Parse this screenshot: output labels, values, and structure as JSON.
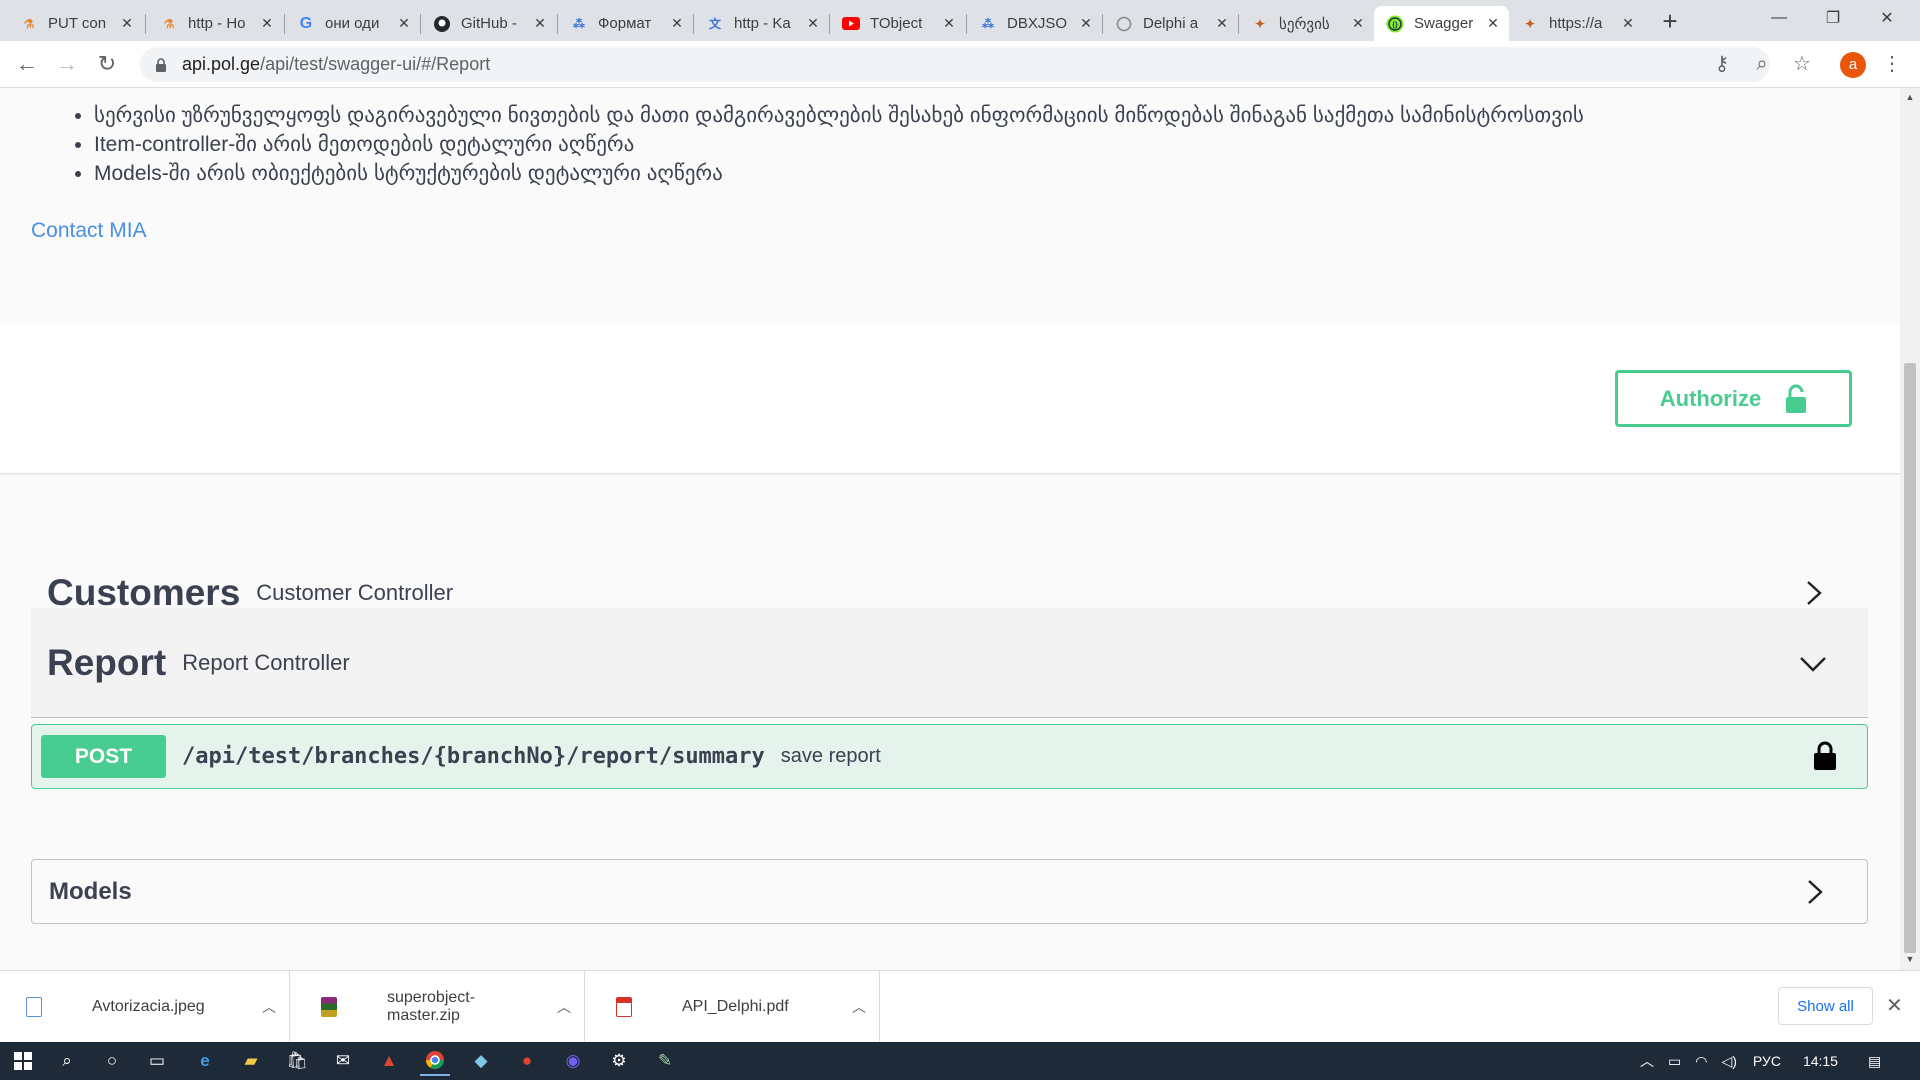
{
  "browser": {
    "tabs": [
      {
        "title": "PUT con",
        "icon": "swagger-favicon",
        "active": false
      },
      {
        "title": "http - Ho",
        "icon": "swagger-favicon",
        "active": false
      },
      {
        "title": "они оди",
        "icon": "google-favicon",
        "active": false
      },
      {
        "title": "GitHub -",
        "icon": "github-favicon",
        "active": false
      },
      {
        "title": "Формат",
        "icon": "blue-dots-favicon",
        "active": false
      },
      {
        "title": "http - Ka",
        "icon": "translate-favicon",
        "active": false
      },
      {
        "title": "TObject",
        "icon": "youtube-favicon",
        "active": false
      },
      {
        "title": "DBXJSO",
        "icon": "blue-dots-favicon",
        "active": false
      },
      {
        "title": "Delphi a",
        "icon": "gray-circle-favicon",
        "active": false
      },
      {
        "title": "სერვის",
        "icon": "emblem-favicon",
        "active": false
      },
      {
        "title": "Swagger",
        "icon": "swagger-green-favicon",
        "active": true
      },
      {
        "title": "https://a",
        "icon": "emblem-favicon",
        "active": false
      }
    ],
    "new_tab": "+",
    "window_controls": {
      "minimize": "—",
      "maximize": "❐",
      "close": "✕"
    },
    "url": {
      "domain": "api.pol.ge",
      "path": "/api/test/swagger-ui/#/Report"
    },
    "avatar_letter": "a"
  },
  "info": {
    "bullets": [
      "სერვისი უზრუნველყოფს დაგირავებული ნივთების და მათი დამგირავებლების შესახებ ინფორმაციის მიწოდებას შინაგან საქმეთა სამინისტროსთვის",
      "Item-controller-ში არის მეთოდების დეტალური აღწერა",
      "Models-ში არის ობიექტების სტრუქტურების დეტალური აღწერა"
    ],
    "contact_link": "Contact MIA"
  },
  "authorize_label": "Authorize",
  "tags": [
    {
      "name": "Customers",
      "description": "Customer Controller",
      "expanded": false
    },
    {
      "name": "Report",
      "description": "Report Controller",
      "expanded": true
    }
  ],
  "operation": {
    "method": "POST",
    "path": "/api/test/branches/{branchNo}/report/summary",
    "summary": "save report"
  },
  "models_label": "Models",
  "downloads": {
    "items": [
      {
        "name": "Avtorizacia.jpeg",
        "icon": "image-file-icon"
      },
      {
        "name": "superobject-master.zip",
        "icon": "archive-file-icon"
      },
      {
        "name": "API_Delphi.pdf",
        "icon": "pdf-file-icon"
      }
    ],
    "show_all": "Show all"
  },
  "taskbar": {
    "language": "РУС",
    "time": "14:15"
  },
  "colors": {
    "accent_green": "#49cc90",
    "link_blue": "#4990e2",
    "text_dark": "#3b4151"
  }
}
